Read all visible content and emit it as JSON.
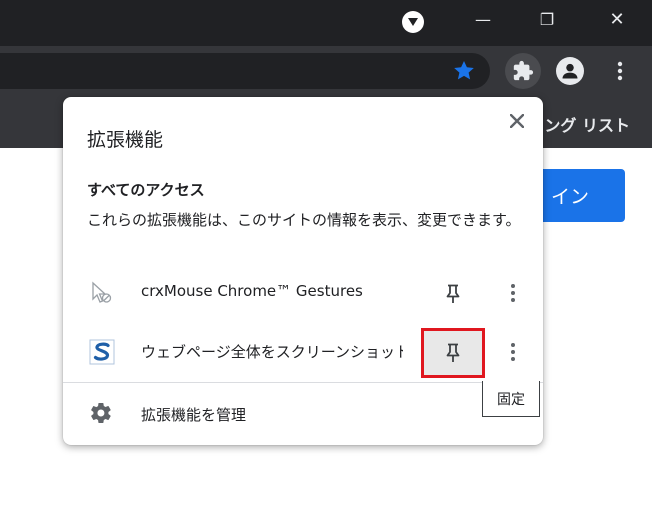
{
  "window": {
    "minimize_glyph": "—",
    "maximize_glyph": "❐",
    "close_glyph": "✕"
  },
  "toolbar": {
    "icons": [
      "tab-search-icon",
      "bookmark-star-icon",
      "extensions-puzzle-icon",
      "profile-icon",
      "kebab-menu-icon"
    ],
    "star_color": "#1a73e8"
  },
  "bookmarks_bar": {
    "reading_list_label": "ディング リスト"
  },
  "page": {
    "signin_label": "イン",
    "signin_color": "#1a73e8"
  },
  "popup": {
    "title": "拡張機能",
    "access_heading": "すべてのアクセス",
    "access_description": "これらの拡張機能は、このサイトの情報を表示、変更できます。",
    "extensions": [
      {
        "name": "crxMouse Chrome™ Gestures",
        "icon": "mouse-cursor-icon",
        "pinned_highlight": false
      },
      {
        "name": "ウェブページ全体をスクリーンショット...",
        "icon": "s-logo-icon",
        "pinned_highlight": true
      }
    ],
    "manage_label": "拡張機能を管理",
    "highlight_color": "#e0171f"
  },
  "tooltip": {
    "text": "固定"
  }
}
